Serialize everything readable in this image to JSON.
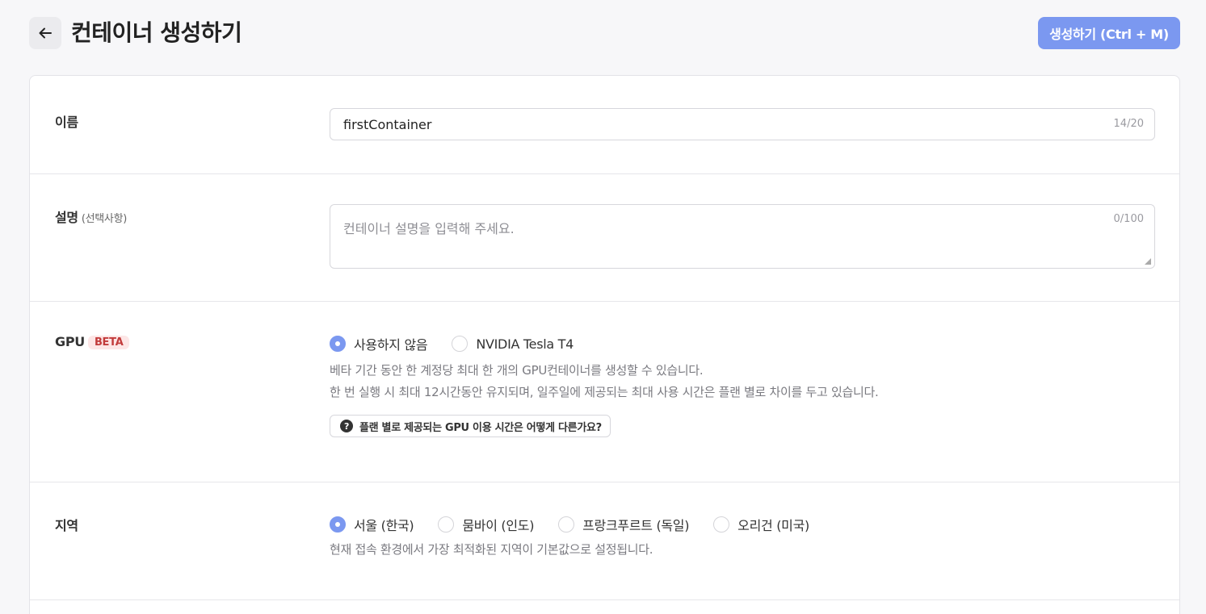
{
  "header": {
    "title": "컨테이너 생성하기",
    "create_button": "생성하기 (Ctrl + M)"
  },
  "form": {
    "name": {
      "label": "이름",
      "value": "firstContainer",
      "counter": "14/20"
    },
    "description": {
      "label": "설명",
      "label_sub": "(선택사항)",
      "placeholder": "컨테이너 설명을 입력해 주세요.",
      "counter": "0/100"
    },
    "gpu": {
      "label": "GPU",
      "badge": "BETA",
      "options": [
        {
          "label": "사용하지 않음",
          "checked": true
        },
        {
          "label": "NVIDIA Tesla T4",
          "checked": false
        }
      ],
      "desc_line1": "베타 기간 동안 한 계정당 최대 한 개의 GPU컨테이너를 생성할 수 있습니다.",
      "desc_line2": "한 번 실행 시 최대 12시간동안 유지되며, 일주일에 제공되는 최대 사용 시간은 플랜 별로 차이를 두고 있습니다.",
      "help_button": "플랜 별로 제공되는 GPU 이용 시간은 어떻게 다른가요?"
    },
    "region": {
      "label": "지역",
      "options": [
        {
          "label": "서울 (한국)",
          "checked": true
        },
        {
          "label": "뭄바이 (인도)",
          "checked": false
        },
        {
          "label": "프랑크푸르트 (독일)",
          "checked": false
        },
        {
          "label": "오리건 (미국)",
          "checked": false
        }
      ],
      "desc": "현재 접속 환경에서 가장 최적화된 지역이 기본값으로 설정됩니다."
    }
  },
  "colors": {
    "accent": "#7b98f0",
    "beta_bg": "#fde6e6",
    "beta_text": "#c23b3b"
  }
}
